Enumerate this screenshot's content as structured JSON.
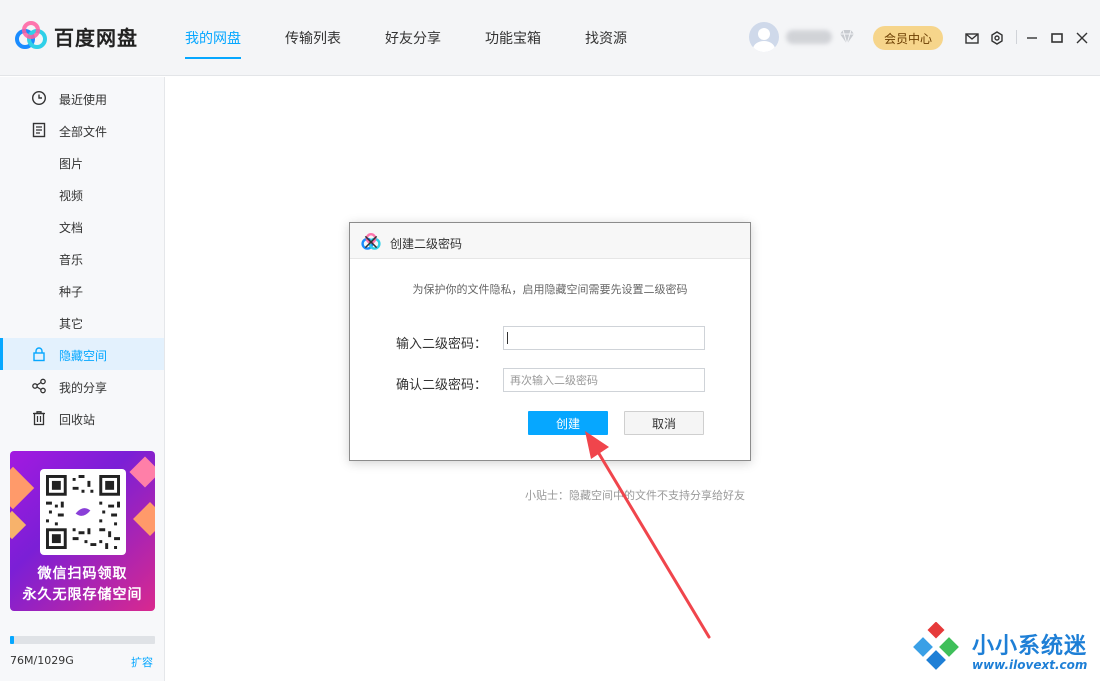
{
  "app": {
    "name": "百度网盘"
  },
  "nav": {
    "items": [
      {
        "label": "我的网盘",
        "active": true
      },
      {
        "label": "传输列表"
      },
      {
        "label": "好友分享"
      },
      {
        "label": "功能宝箱"
      },
      {
        "label": "找资源"
      }
    ]
  },
  "header": {
    "vip_label": "会员中心"
  },
  "sidebar": {
    "items": [
      {
        "label": "最近使用",
        "icon": "clock-icon"
      },
      {
        "label": "全部文件",
        "icon": "document-icon"
      },
      {
        "label": "图片"
      },
      {
        "label": "视频"
      },
      {
        "label": "文档"
      },
      {
        "label": "音乐"
      },
      {
        "label": "种子"
      },
      {
        "label": "其它"
      },
      {
        "label": "隐藏空间",
        "icon": "lock-icon",
        "active": true
      },
      {
        "label": "我的分享",
        "icon": "share-icon"
      },
      {
        "label": "回收站",
        "icon": "trash-icon"
      }
    ],
    "promo": {
      "line1": "微信扫码领取",
      "line2": "永久无限存储空间"
    },
    "quota": {
      "text": "76M/1029G",
      "used_fraction": 0.03,
      "expand_label": "扩容"
    }
  },
  "main": {
    "tip": "小贴士：隐藏空间中的文件不支持分享给好友"
  },
  "dialog": {
    "title": "创建二级密码",
    "description": "为保护你的文件隐私，启用隐藏空间需要先设置二级密码",
    "password_label": "输入二级密码：",
    "password_value": "",
    "confirm_label": "确认二级密码：",
    "confirm_placeholder": "再次输入二级密码",
    "create_label": "创建",
    "cancel_label": "取消"
  },
  "watermark": {
    "cn": "小小系统迷",
    "en": "www.ilovext.com"
  },
  "colors": {
    "accent": "#06a7ff",
    "vip": "#f6d58b",
    "arrow": "#f0454c"
  }
}
